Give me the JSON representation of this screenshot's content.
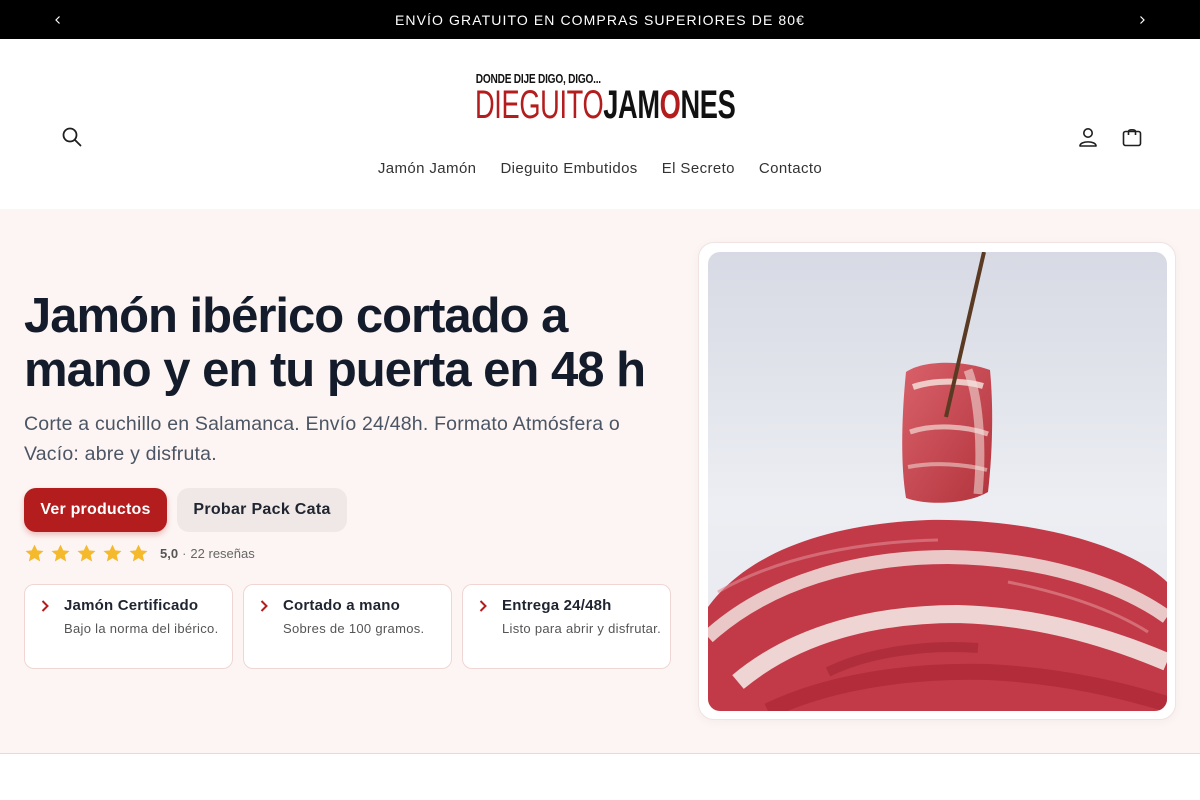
{
  "announcement": {
    "text": "ENVÍO GRATUITO EN COMPRAS SUPERIORES DE 80€"
  },
  "header": {
    "logo": {
      "tagline": "DONDE DIJE DIGO, DIGO...",
      "name_part1": "DIEGUITO",
      "name_part2a": "JAM",
      "name_part2b": "O",
      "name_part2c": "NES"
    },
    "nav": [
      {
        "label": "Jamón Jamón"
      },
      {
        "label": "Dieguito Embutidos"
      },
      {
        "label": "El Secreto"
      },
      {
        "label": "Contacto"
      }
    ]
  },
  "hero": {
    "title": "Jamón ibérico cortado a mano y en tu puerta en 48 h",
    "subtitle": "Corte a cuchillo en Salamanca. Envío 24/48h. Formato Atmósfera o Vacío: abre y disfruta.",
    "primary_button": "Ver productos",
    "secondary_button": "Probar Pack Cata",
    "rating": {
      "stars": 5,
      "score": "5,0",
      "separator": "·",
      "count": "22 reseñas"
    },
    "features": [
      {
        "title": "Jamón Certificado",
        "description": "Bajo la norma del ibérico."
      },
      {
        "title": "Cortado a mano",
        "description": "Sobres de 100 gramos."
      },
      {
        "title": "Entrega 24/48h",
        "description": "Listo para abrir y disfrutar."
      }
    ]
  },
  "colors": {
    "brand_red": "#b31d1d",
    "star_yellow": "#f5b92e",
    "hero_bg": "#fdf5f3",
    "title_dark": "#141c2b"
  },
  "icons": {
    "announcement_prev": "chevron-left-icon",
    "announcement_next": "chevron-right-icon",
    "search": "search-icon",
    "account": "user-icon",
    "cart": "bag-icon",
    "feature_bullet": "chevron-right-icon",
    "rating": "star-icon"
  }
}
